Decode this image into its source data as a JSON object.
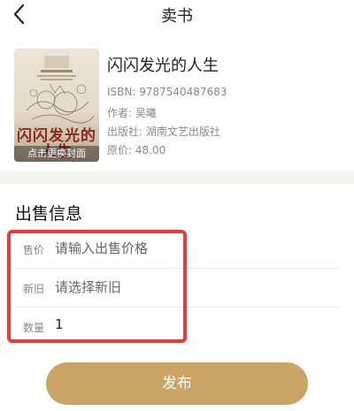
{
  "nav": {
    "title": "卖书",
    "back_icon": "chevron-left-icon"
  },
  "book": {
    "title": "闪闪发光的人生",
    "cover_title": "闪闪发光的人生",
    "cover_hint": "点击更换封面",
    "isbn": "ISBN: 9787540487683",
    "author": "作者: 吴曦",
    "publisher": "出版社: 湖南文艺出版社",
    "price": "原价: 48.00"
  },
  "sale": {
    "section_title": "出售信息",
    "fields": [
      {
        "label": "售价",
        "placeholder": "请输入出售价格"
      },
      {
        "label": "新旧",
        "placeholder": "请选择新旧"
      },
      {
        "label": "数量",
        "value": "1"
      }
    ]
  },
  "actions": {
    "publish_label": "发布"
  },
  "colors": {
    "accent": "#c9a465",
    "highlight": "#e8393b",
    "cover_title": "#8c2b1c"
  }
}
